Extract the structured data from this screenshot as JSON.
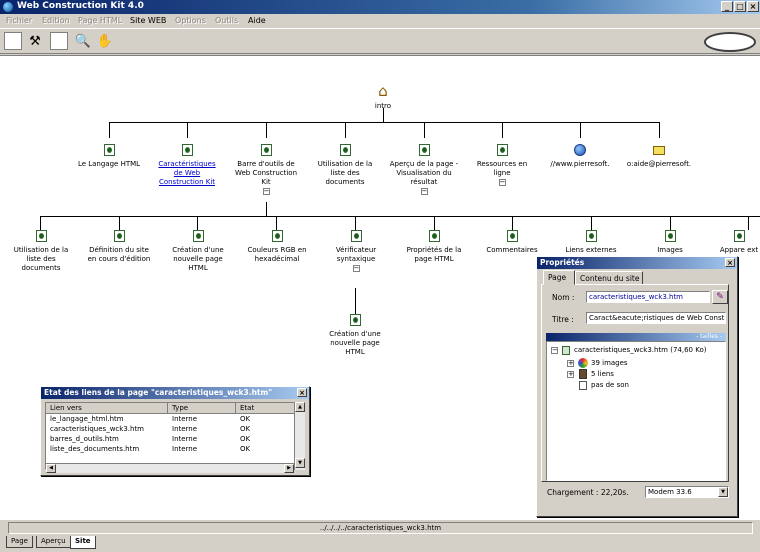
{
  "window": {
    "title": "Web Construction Kit 4.0",
    "min": "_",
    "max": "□",
    "close": "×"
  },
  "menu": [
    {
      "label": "Fichier",
      "enabled": false
    },
    {
      "label": "Edition",
      "enabled": false
    },
    {
      "label": "Page HTML",
      "enabled": false
    },
    {
      "label": "Site WEB",
      "enabled": true
    },
    {
      "label": "Options",
      "enabled": false
    },
    {
      "label": "Outils",
      "enabled": false
    },
    {
      "label": "Aide",
      "enabled": true
    }
  ],
  "toolbar": {
    "icons": [
      "tools-icon",
      "preview-icon",
      "hand-icon"
    ]
  },
  "tree": {
    "root": "intro",
    "level1": [
      "Le Langage HTML",
      "Caractéristiques de Web Construction Kit",
      "Barre d'outils de Web Construction Kit",
      "Utilisation de la liste des documents",
      "Aperçu de la page - Visualisation du résultat",
      "Ressources en ligne",
      "//www.pierresoft.",
      "o:aide@pierresoft."
    ],
    "level2": [
      "Utilisation de la liste des documents",
      "Définition du site en cours d'édition",
      "Création d'une nouvelle page HTML",
      "Couleurs RGB en hexadécimal",
      "Vérificateur syntaxique",
      "Propriétés de la page HTML",
      "Commentaires",
      "Liens externes",
      "Images",
      "Appare ext"
    ],
    "level3": "Création d'une nouvelle page HTML",
    "expander": "−"
  },
  "status": {
    "path": "../../../../caracteristiques_wck3.htm"
  },
  "bottom_tabs": [
    "Page",
    "Aperçu",
    "Site"
  ],
  "links_window": {
    "title": "Etat des liens de la page \"caracteristiques_wck3.htm\"",
    "columns": [
      "Lien vers",
      "Type",
      "Etat"
    ],
    "rows": [
      [
        "le_langage_html.htm",
        "Interne",
        "OK"
      ],
      [
        "caracteristiques_wck3.htm",
        "Interne",
        "OK"
      ],
      [
        "barres_d_outils.htm",
        "Interne",
        "OK"
      ],
      [
        "liste_des_documents.htm",
        "Interne",
        "OK"
      ]
    ]
  },
  "properties": {
    "title": "Propriétés",
    "tabs": [
      "Page",
      "Contenu du site"
    ],
    "name_label": "Nom :",
    "name_value": "caracteristiques_wck3.htm",
    "title_label": "Titre :",
    "title_value": "Caract&eacute;ristiques de Web Constru",
    "sizes_label": "- tailles -",
    "file_node": "caracteristiques_wck3.htm (74,60 Ko)",
    "children": [
      "39 images",
      "5 liens",
      "pas de son"
    ],
    "load_label": "Chargement : 22,20s.",
    "modem": "Modem 33.6"
  }
}
